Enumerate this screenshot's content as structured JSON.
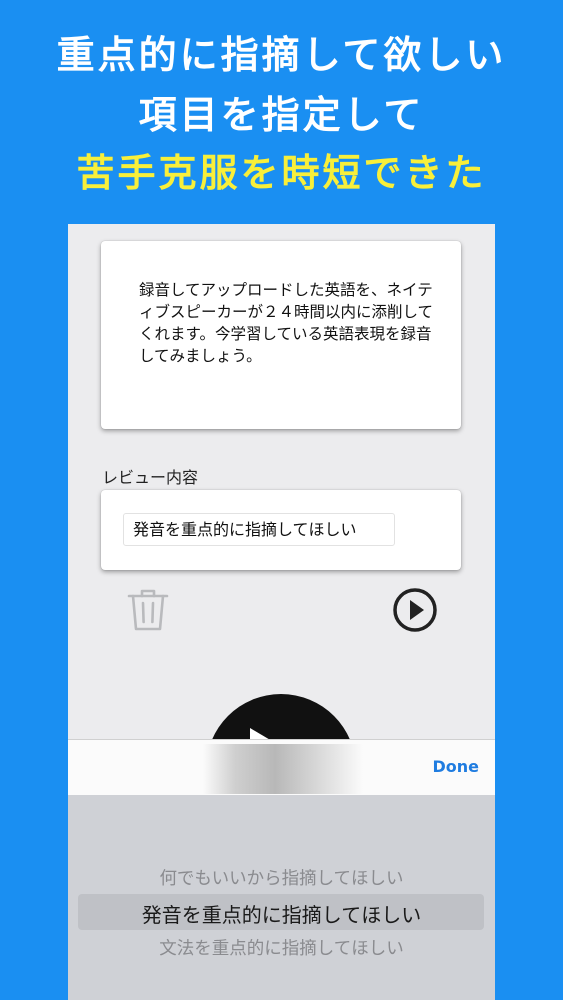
{
  "headline": {
    "line1": "重点的に指摘して欲しい",
    "line2": "項目を指定して",
    "line3": "苦手克服を時短できた"
  },
  "description": {
    "text": "録音してアップロードした英語を、ネイティブスピーカーが２４時間以内に添削してくれます。今学習している英語表現を録音してみましょう。"
  },
  "review": {
    "label": "レビュー内容",
    "value": "発音を重点的に指摘してほしい"
  },
  "toolbar": {
    "done_label": "Done"
  },
  "picker": {
    "options": [
      "何でもいいから指摘してほしい",
      "発音を重点的に指摘してほしい",
      "文法を重点的に指摘してほしい"
    ],
    "selected_index": 1
  },
  "colors": {
    "background": "#1a8ff2",
    "headline_accent": "#f8ef3a",
    "done": "#1f7ce0"
  }
}
